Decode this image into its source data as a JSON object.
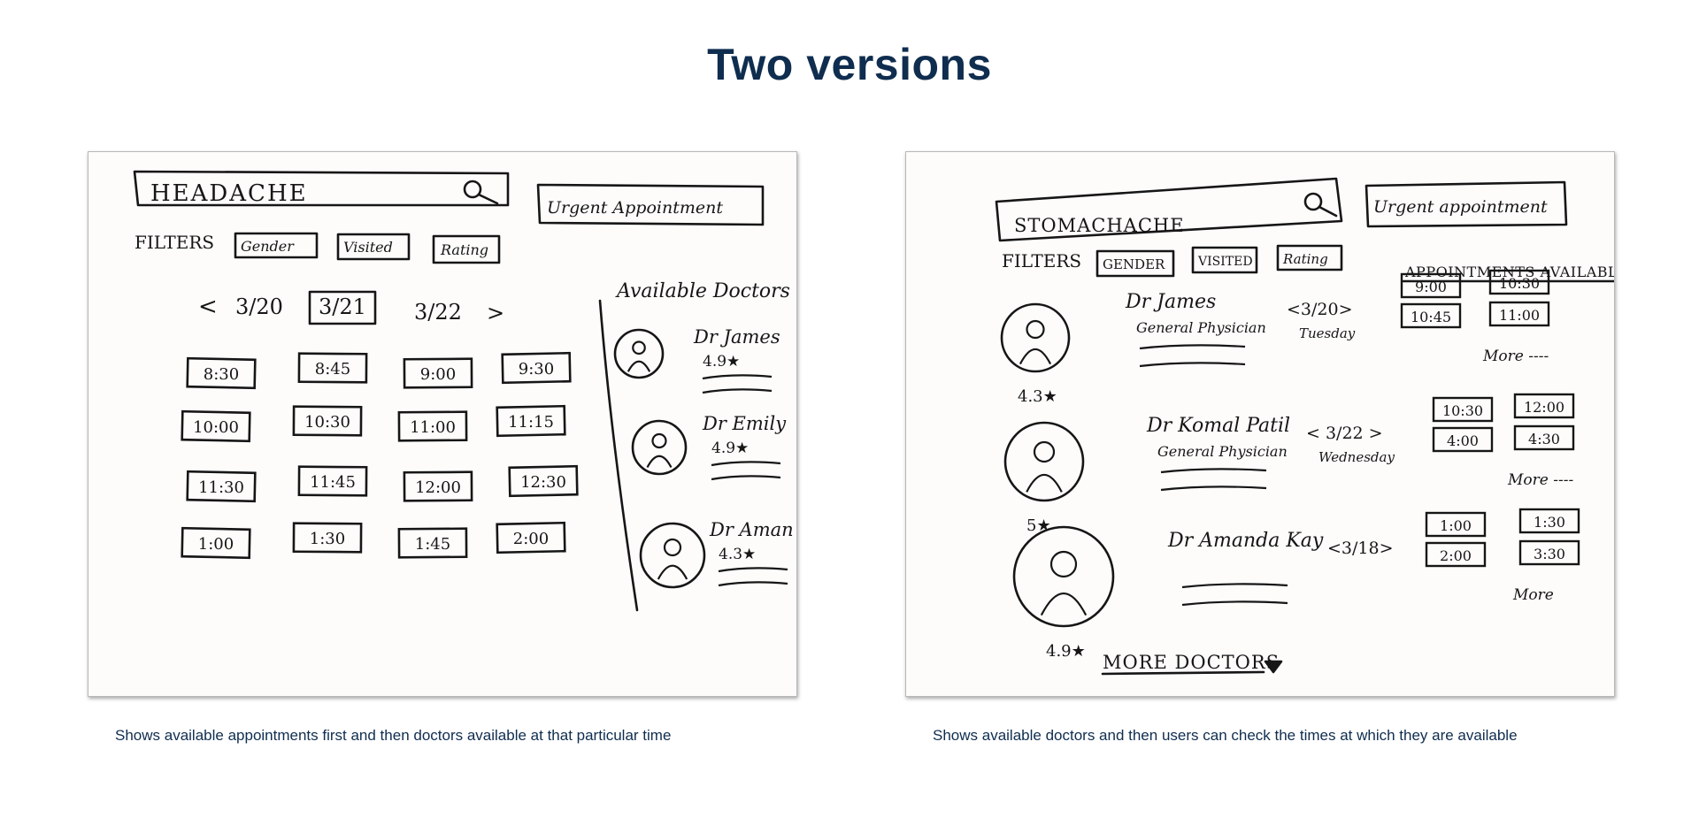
{
  "page": {
    "title": "Two versions"
  },
  "version1": {
    "search_text": "HEADACHE",
    "urgent_button": "Urgent Appointment",
    "filters_label": "FILTERS",
    "filters": [
      "Gender",
      "Visited",
      "Rating"
    ],
    "date_prev": "<",
    "date_next": ">",
    "dates": [
      "3/20",
      "3/21",
      "3/22"
    ],
    "times": [
      [
        "8:30",
        "8:45",
        "9:00",
        "9:30"
      ],
      [
        "10:00",
        "10:30",
        "11:00",
        "11:15"
      ],
      [
        "11:30",
        "11:45",
        "12:00",
        "12:30"
      ],
      [
        "1:00",
        "1:30",
        "1:45",
        "2:00"
      ]
    ],
    "available_label": "Available Doctors",
    "doctors": [
      {
        "name": "Dr James",
        "rating": "4.9★"
      },
      {
        "name": "Dr Emily",
        "rating": "4.9★"
      },
      {
        "name": "Dr Aman",
        "rating": "4.3★"
      }
    ],
    "caption": "Shows available appointments first and then doctors available at that particular time"
  },
  "version2": {
    "search_text": "STOMACHACHE",
    "urgent_button": "Urgent appointment",
    "filters_label": "FILTERS",
    "filters": [
      "GENDER",
      "VISITED",
      "Rating"
    ],
    "appointments_label": "APPOINTMENTS AVAILABLE",
    "doctors": [
      {
        "name": "Dr James",
        "specialty": "General Physician",
        "rating": "4.3★",
        "date": "<3/20>",
        "day": "Tuesday",
        "times": [
          "9:00",
          "10:30",
          "10:45",
          "11:00"
        ],
        "more": "More ----"
      },
      {
        "name": "Dr Komal Patil",
        "specialty": "General Physician",
        "rating": "5★",
        "date": "< 3/22 >",
        "day": "Wednesday",
        "times": [
          "10:30",
          "12:00",
          "4:00",
          "4:30"
        ],
        "more": "More ----"
      },
      {
        "name": "Dr Amanda Kay",
        "specialty": "",
        "rating": "4.9★",
        "date": "<3/18>",
        "day": "",
        "times": [
          "1:00",
          "1:30",
          "2:00",
          "3:30"
        ],
        "more": "More"
      }
    ],
    "more_doctors": "MORE DOCTORS",
    "caption": "Shows available doctors and then users can check the times at which they are available"
  }
}
